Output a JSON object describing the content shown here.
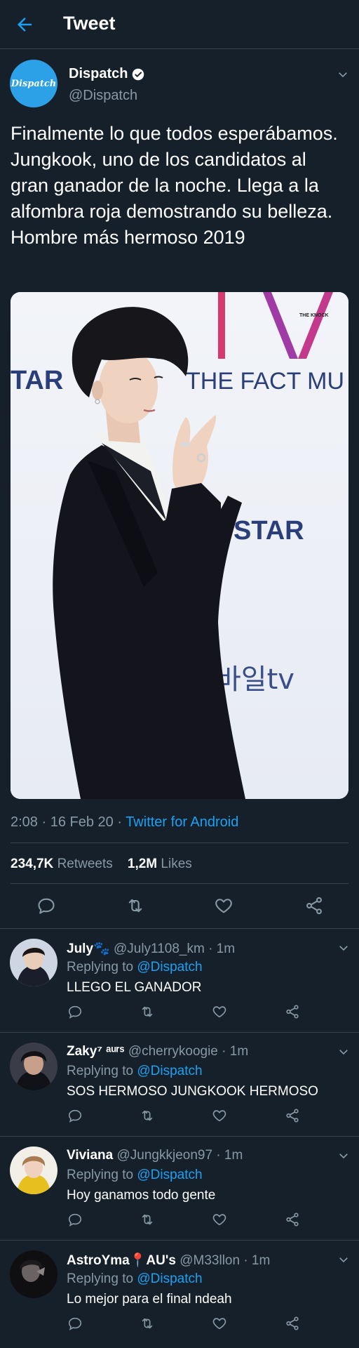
{
  "header": {
    "title": "Tweet"
  },
  "tweet": {
    "author": {
      "name": "Dispatch",
      "handle": "@Dispatch",
      "avatar_text": "Dispatch"
    },
    "text": "Finalmente lo que todos esperábamos. Jungkook, uno de los candidatos al gran ganador de la noche. Llega a la alfombra roja demostrando su belleza. Hombre más hermoso 2019",
    "photo_text": {
      "left": "TAR",
      "fact": "THE FACT MU",
      "star": "STAR",
      "korean": "바일tv",
      "logo": "THE KNOCK"
    },
    "time": "2:08 · 16 Feb 20 · ",
    "source": "Twitter for Android",
    "retweets_count": "234,7K",
    "retweets_label": "Retweets",
    "likes_count": "1,2M",
    "likes_label": "Likes"
  },
  "replies": [
    {
      "name": "July🐾",
      "handle": "@July1108_km · 1m",
      "replying_label": "Replying to ",
      "mention": "@Dispatch",
      "text": "LLEGO EL GANADOR"
    },
    {
      "name": "Zaky⁷ ᵃᵘʳˢ",
      "handle": "@cherrykoogie · 1m",
      "replying_label": "Replying to ",
      "mention": "@Dispatch",
      "text": "SOS HERMOSO JUNGKOOK HERMOSO"
    },
    {
      "name": "Viviana",
      "handle": "@Jungkkjeon97 · 1m",
      "replying_label": "Replying to ",
      "mention": "@Dispatch",
      "text": "Hoy ganamos todo gente"
    },
    {
      "name": "AstroYma📍AU's",
      "handle": "@M33llon · 1m",
      "replying_label": "Replying to ",
      "mention": "@Dispatch",
      "text": "Lo mejor para el final ndeah"
    }
  ],
  "colors": {
    "background": "#15202b",
    "accent": "#1da1f2",
    "muted": "#8899a6",
    "divider": "#38444d"
  },
  "icons": [
    "back-arrow-icon",
    "verified-icon",
    "chevron-down-icon",
    "reply-icon",
    "retweet-icon",
    "like-icon",
    "share-icon"
  ]
}
